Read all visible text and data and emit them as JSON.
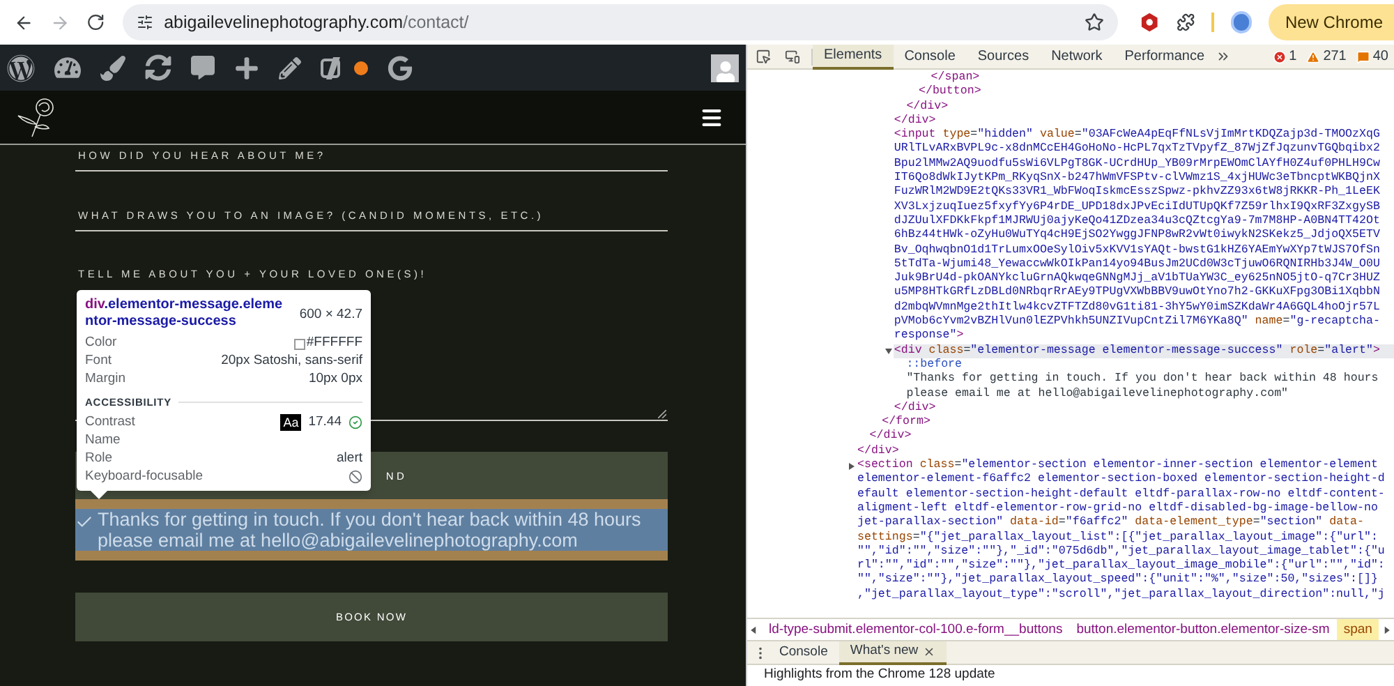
{
  "browser": {
    "url": {
      "host": "abigailevelinephotography.com",
      "path": "/contact/"
    },
    "update_button": "New Chrome"
  },
  "site": {
    "fields": [
      {
        "label": "HOW DID YOU HEAR ABOUT ME?",
        "kind": "line"
      },
      {
        "label": "WHAT DRAWS YOU TO AN IMAGE? (CANDID MOMENTS, ETC.)",
        "kind": "line"
      },
      {
        "label": "TELL ME ABOUT YOU + YOUR LOVED ONE(S)!",
        "kind": "textarea"
      }
    ],
    "send_button": "ND",
    "message": "Thanks for getting in touch. If you don't hear back within 48 hours please email me at hello@abigailevelinephotography.com",
    "book_button": "BOOK NOW"
  },
  "tooltip": {
    "selector": {
      "tag": "div",
      "classes": ".elementor-message.elementor-message-success"
    },
    "size": "600 × 42.7",
    "rows": [
      {
        "label": "Color",
        "value": "#FFFFFF",
        "kind": "color"
      },
      {
        "label": "Font",
        "value": "20px Satoshi, sans-serif",
        "kind": "text"
      },
      {
        "label": "Margin",
        "value": "10px 0px",
        "kind": "text"
      }
    ],
    "section": "ACCESSIBILITY",
    "a11y_rows": [
      {
        "label": "Contrast",
        "swatch": "Aa",
        "value": "17.44",
        "kind": "contrast"
      },
      {
        "label": "Name",
        "kind": "empty"
      },
      {
        "label": "Role",
        "value": "alert",
        "kind": "text"
      },
      {
        "label": "Keyboard-focusable",
        "kind": "not-focusable"
      }
    ]
  },
  "devtools": {
    "tabs": [
      {
        "label": "Elements",
        "selected": true
      },
      {
        "label": "Console",
        "selected": false
      },
      {
        "label": "Sources",
        "selected": false
      },
      {
        "label": "Network",
        "selected": false
      },
      {
        "label": "Performance",
        "selected": false
      }
    ],
    "counts": {
      "errors": "1",
      "warnings": "271",
      "issues": "40"
    },
    "dom": [
      {
        "selected": false,
        "children": [
          {
            "selected": false,
            "children": [
              {
                "selected": false,
                "children": [
                  {
                    "selected": false,
                    "children": [
                      {
                        "selected": false,
                        "children": [
                          {
                            "selected": false,
                            "children": [
                              {
                                "selected": false,
                                "close": "</span>"
                              }
                            ],
                            "close": "</button>"
                          }
                        ],
                        "close": "</div>"
                      }
                    ],
                    "close": "</div>"
                  },
                  {
                    "selected": false,
                    "lines": [
                      [
                        {
                          "kind": "tag",
                          "text": "<input"
                        },
                        {
                          "kind": "attr",
                          "text": " type"
                        },
                        {
                          "kind": "eq",
                          "text": "="
                        },
                        {
                          "kind": "val",
                          "text": "\"hidden\""
                        },
                        {
                          "kind": "attr",
                          "text": " value"
                        },
                        {
                          "kind": "eq",
                          "text": "="
                        },
                        {
                          "kind": "val",
                          "text": "\"03AFcWeA4pEqFfNLsVjImMrtKDQZajp3d-TMOOzXqG"
                        }
                      ],
                      [
                        {
                          "kind": "val",
                          "text": "URlTLvARxBVPL9c-x8dnMCcEH4GoHoNo-HcPL7qxTzTVpyfZ_87WjZfJqzunvTGQbqibx2"
                        }
                      ],
                      [
                        {
                          "kind": "val",
                          "text": "Bpu2lMMw2AQ9uodfu5sWi6VLPgT8GK-UCrdHUp_YB09rMrpEWOmClAYfH0Z4uf0PHLH9Cw"
                        }
                      ],
                      [
                        {
                          "kind": "val",
                          "text": "IT6Qo8dWkIJytKPm_RKyqSnX-b247hWmVFSPtv-clVWmz1S_4xjHUWc3eTbncptWKBQjnX"
                        }
                      ],
                      [
                        {
                          "kind": "val",
                          "text": "FuzWRlM2WD9E2tQKs33VR1_WbFWoqIskmcEsszSpwz-pkhvZZ93x6tW8jRKKR-Ph_1LeEK"
                        }
                      ],
                      [
                        {
                          "kind": "val",
                          "text": "XV3LxjzuqIuez5fxyfYy6P4rDE_UPD18dxJPvEciIdUTUpQKf7Z59rlhxI9QxRF3ZxgySB"
                        }
                      ],
                      [
                        {
                          "kind": "val",
                          "text": "dJZUulXFDKkFkpf1MJRWUj0ajyKeQo41ZDzea34u3cQZtcgYa9-7m7M8HP-A0BN4TT42Ot"
                        }
                      ],
                      [
                        {
                          "kind": "val",
                          "text": "6hBz44tHWk-oZyHu0WuTYq4cH9EjSO2YwggJFNP8wR2vWt0iwykN2SKekz5_JdjoQX5ETV"
                        }
                      ],
                      [
                        {
                          "kind": "val",
                          "text": "Bv_OqhwqbnO1d1TrLumxOOeSylOiv5xKVV1sYAQt-bwstG1kHZ6YAEmYwXYp7tWJS7OfSn"
                        }
                      ],
                      [
                        {
                          "kind": "val",
                          "text": "5tTdTa-Wjumi48_YewaccwWkOIkPan14yo94BusJm2UCd0W3cTjuwO6RQNIRHb3J4W_O0U"
                        }
                      ],
                      [
                        {
                          "kind": "val",
                          "text": "Juk9BrU4d-pkOANYkcluGrnAQkwqeGNNgMJj_aV1bTUaYW3C_ey625nNO5jtO-q7Cr3HUZ"
                        }
                      ],
                      [
                        {
                          "kind": "val",
                          "text": "u5MP8HTkGRfLzDBLd0NRbqrRrAEy9TPUgVXWbBBV9uwOtYno7h2-GKKuXFpg3OBi1XqbbN"
                        }
                      ],
                      [
                        {
                          "kind": "val",
                          "text": "d2mbqWVmnMge2thItlw4kcvZTFTZd80vG1ti81-3hY5wY0imSZKdaWr4A6GQL4hoOjr57L"
                        }
                      ],
                      [
                        {
                          "kind": "val",
                          "text": "pVMob6cYvm2vBZHlVun0lEZPVhkh5UNZIVupCntZil7M6YKa8Q\""
                        },
                        {
                          "kind": "attr",
                          "text": " name"
                        },
                        {
                          "kind": "eq",
                          "text": "="
                        },
                        {
                          "kind": "val",
                          "text": "\"g-recaptcha-"
                        }
                      ],
                      [
                        {
                          "kind": "val",
                          "text": "response\""
                        },
                        {
                          "kind": "tag",
                          "text": ">"
                        }
                      ]
                    ]
                  },
                  {
                    "selected": true,
                    "expanded": true,
                    "lines": [
                      [
                        {
                          "kind": "tag",
                          "text": "<div"
                        },
                        {
                          "kind": "attr",
                          "text": " class"
                        },
                        {
                          "kind": "eq",
                          "text": "="
                        },
                        {
                          "kind": "val",
                          "text": "\"elementor-message elementor-message-success\""
                        },
                        {
                          "kind": "attr",
                          "text": " role"
                        },
                        {
                          "kind": "eq",
                          "text": "="
                        },
                        {
                          "kind": "val",
                          "text": "\"alert\""
                        },
                        {
                          "kind": "tag",
                          "text": ">"
                        }
                      ]
                    ],
                    "children": [
                      {
                        "selected": false,
                        "lines": [
                          [
                            {
                              "kind": "pseudo",
                              "text": "::before"
                            }
                          ]
                        ]
                      },
                      {
                        "selected": false,
                        "lines": [
                          [
                            {
                              "kind": "text",
                              "text": "\"Thanks for getting in touch. If you don't hear back within 48 hours"
                            }
                          ],
                          [
                            {
                              "kind": "text",
                              "text": "please email me at hello@abigailevelinephotography.com\""
                            }
                          ]
                        ]
                      }
                    ],
                    "close": "</div>"
                  }
                ],
                "close": "</form>"
              }
            ],
            "close": "</div>"
          }
        ],
        "close": "</div>"
      },
      {
        "selected": false,
        "expanded": false,
        "lines": [
          [
            {
              "kind": "tag",
              "text": "<section"
            },
            {
              "kind": "attr",
              "text": " class"
            },
            {
              "kind": "eq",
              "text": "="
            },
            {
              "kind": "val",
              "text": "\"elementor-section elementor-inner-section elementor-element"
            }
          ],
          [
            {
              "kind": "val",
              "text": "elementor-element-f6affc2 elementor-section-boxed elementor-section-height-d"
            }
          ],
          [
            {
              "kind": "val",
              "text": "efault elementor-section-height-default eltdf-parallax-row-no eltdf-content-"
            }
          ],
          [
            {
              "kind": "val",
              "text": "aligment-left eltdf-elementor-row-grid-no eltdf-disabled-bg-image-bellow-no"
            }
          ],
          [
            {
              "kind": "val",
              "text": "jet-parallax-section\""
            },
            {
              "kind": "attr",
              "text": " data-id"
            },
            {
              "kind": "eq",
              "text": "="
            },
            {
              "kind": "val",
              "text": "\"f6affc2\""
            },
            {
              "kind": "attr",
              "text": " data-element_type"
            },
            {
              "kind": "eq",
              "text": "="
            },
            {
              "kind": "val",
              "text": "\"section\""
            },
            {
              "kind": "attr",
              "text": " data-"
            }
          ],
          [
            {
              "kind": "attr",
              "text": "settings"
            },
            {
              "kind": "eq",
              "text": "="
            },
            {
              "kind": "val",
              "text": "\"{\"jet_parallax_layout_list\":[{\"jet_parallax_layout_image\":{\"url\":"
            }
          ],
          [
            {
              "kind": "val",
              "text": "\"\",\"id\":\"\",\"size\":\"\"},\"_id\":\"075d6db\",\"jet_parallax_layout_image_tablet\":{\"u"
            }
          ],
          [
            {
              "kind": "val",
              "text": "rl\":\"\",\"id\":\"\",\"size\":\"\"},\"jet_parallax_layout_image_mobile\":{\"url\":\"\",\"id\":"
            }
          ],
          [
            {
              "kind": "val",
              "text": "\"\",\"size\":\"\"},\"jet_parallax_layout_speed\":{\"unit\":\"%\",\"size\":50,\"sizes\":[]}"
            }
          ],
          [
            {
              "kind": "val",
              "text": ",\"jet_parallax_layout_type\":\"scroll\",\"jet_parallax_layout_direction\":null,\"j"
            }
          ]
        ]
      }
    ],
    "breadcrumbs": [
      {
        "text": "ld-type-submit.elementor-col-100.e-form__buttons",
        "selected": false
      },
      {
        "text": "button.elementor-button.elementor-size-sm",
        "selected": false
      },
      {
        "text": "span",
        "selected": true
      }
    ],
    "drawer": {
      "tabs": [
        {
          "label": "Console",
          "selected": false,
          "closable": false
        },
        {
          "label": "What's new",
          "selected": true,
          "closable": true
        }
      ],
      "content": "Highlights from the Chrome 128 update"
    }
  }
}
